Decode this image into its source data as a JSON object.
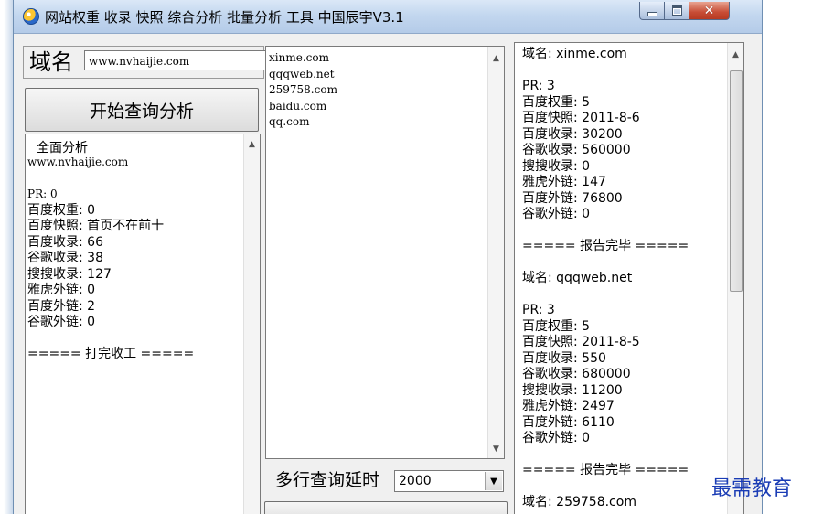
{
  "window": {
    "title": "网站权重 收录 快照 综合分析 批量分析 工具 中国辰宇V3.1"
  },
  "domain": {
    "label": "域名",
    "value": "www.nvhaijie.com"
  },
  "start_button": {
    "label": "开始查询分析"
  },
  "left_panel": {
    "title": "全面分析",
    "lines": [
      "www.nvhaijie.com",
      "",
      "PR: 0",
      "百度权重: 0",
      "百度快照: 首页不在前十",
      "百度收录: 66",
      "谷歌收录: 38",
      "搜搜收录: 127",
      "雅虎外链: 0",
      "百度外链: 2",
      "谷歌外链: 0",
      "",
      "=====    打完收工    ====="
    ]
  },
  "middle_panel": {
    "lines": [
      "xinme.com",
      "qqqweb.net",
      "259758.com",
      "baidu.com",
      "qq.com"
    ]
  },
  "right_panel": {
    "lines": [
      "域名:  xinme.com",
      "",
      "PR: 3",
      "百度权重: 5",
      "百度快照: 2011-8-6",
      "百度收录: 30200",
      "谷歌收录: 560000",
      "搜搜收录: 0",
      "雅虎外链: 147",
      "百度外链: 76800",
      "谷歌外链: 0",
      "",
      "=====    报告完毕    =====",
      "",
      "域名:  qqqweb.net",
      "",
      "PR: 3",
      "百度权重: 5",
      "百度快照: 2011-8-5",
      "百度收录: 550",
      "谷歌收录: 680000",
      "搜搜收录: 11200",
      "雅虎外链: 2497",
      "百度外链: 6110",
      "谷歌外链: 0",
      "",
      "=====    报告完毕    =====",
      "",
      "域名:  259758.com"
    ]
  },
  "delay": {
    "label": "多行查询延时",
    "value": "2000"
  },
  "watermark": {
    "text": "最需教育"
  },
  "colors": {
    "titlebar": "#c3d7ef",
    "close_button": "#c74c35",
    "watermark": "#1a3cb5"
  },
  "icons": [
    "app-icon",
    "minimize-icon",
    "maximize-icon",
    "close-icon",
    "scroll-up-icon",
    "scroll-down-icon",
    "dropdown-arrow-icon"
  ]
}
